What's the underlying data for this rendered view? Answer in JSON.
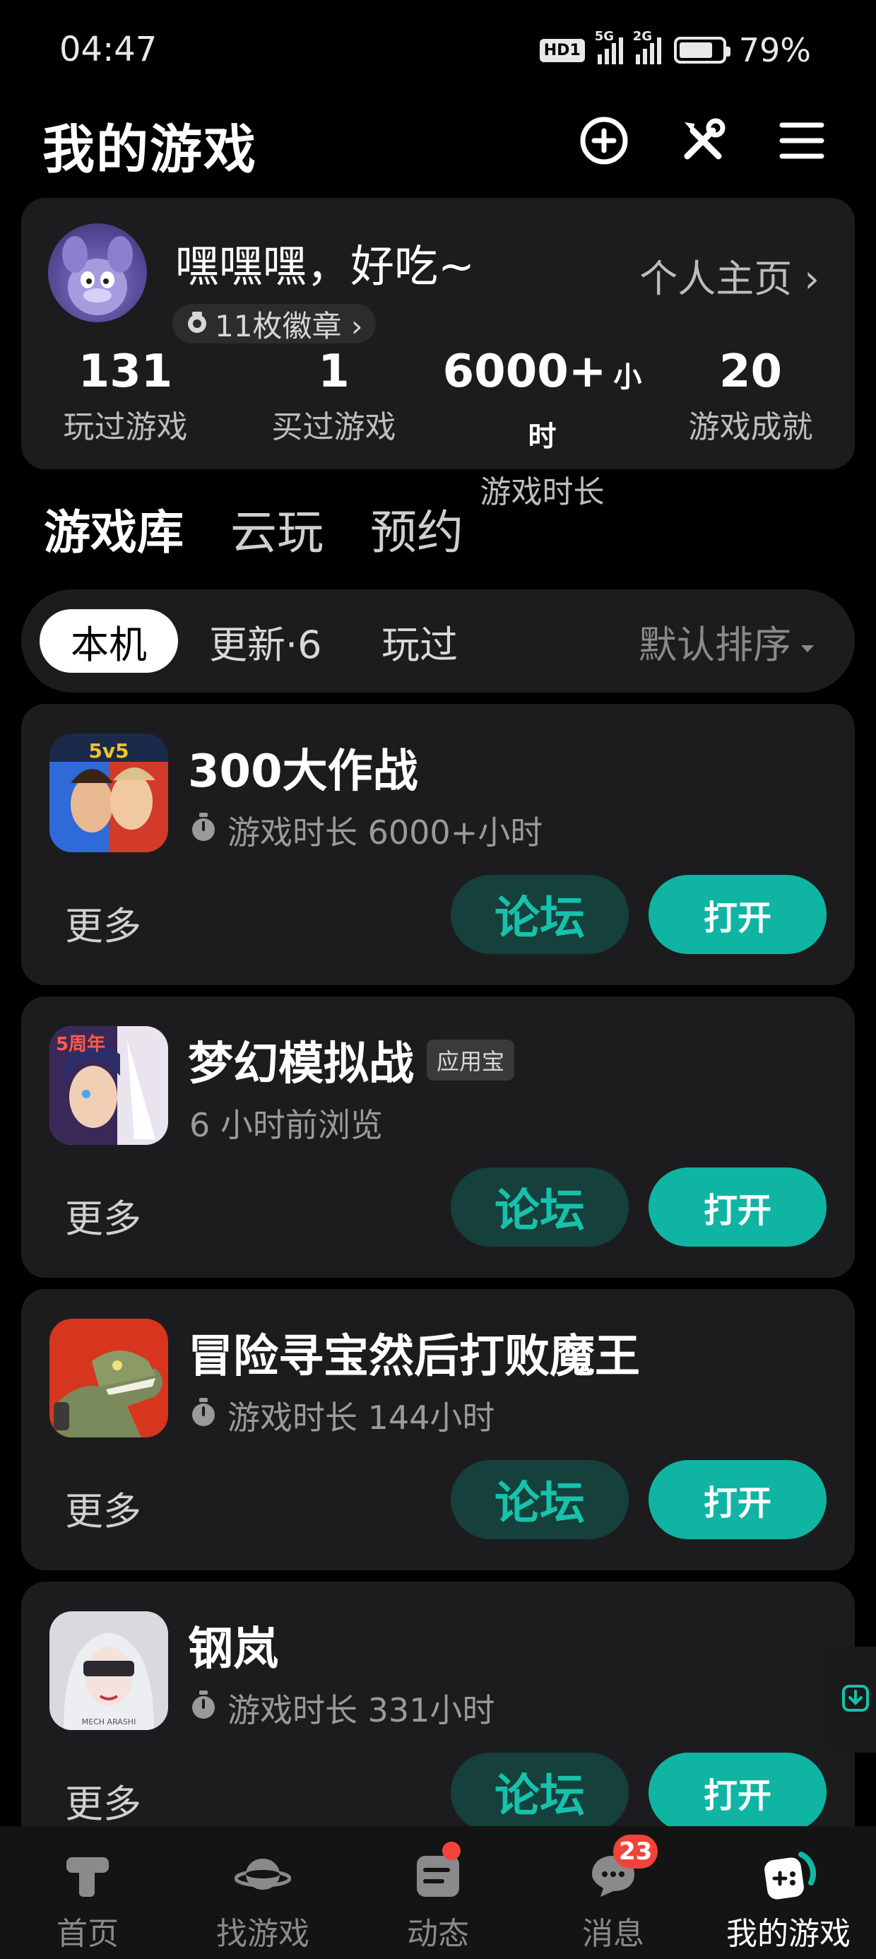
{
  "status_bar": {
    "time": "04:47",
    "hd_label": "HD1",
    "net1_label": "5G",
    "net2_label": "2G",
    "battery_level": 0.79,
    "battery_text": "79%"
  },
  "header": {
    "title": "我的游戏",
    "icons": [
      "add-circle-icon",
      "tools-icon",
      "menu-icon"
    ]
  },
  "profile": {
    "username": "嘿嘿嘿，好吃~",
    "homepage_label": "个人主页 ›",
    "badges_label": "11枚徽章 ›",
    "stats": [
      {
        "value": "131",
        "unit": "",
        "label": "玩过游戏"
      },
      {
        "value": "1",
        "unit": "",
        "label": "买过游戏"
      },
      {
        "value": "6000+",
        "unit": "小时",
        "label": "游戏时长"
      },
      {
        "value": "20",
        "unit": "",
        "label": "游戏成就"
      }
    ]
  },
  "library_tabs": [
    {
      "label": "游戏库",
      "active": true
    },
    {
      "label": "云玩",
      "active": false
    },
    {
      "label": "预约",
      "active": false
    }
  ],
  "filters": {
    "chips": [
      {
        "label": "本机",
        "active": true
      },
      {
        "label": "更新·6",
        "active": false
      },
      {
        "label": "玩过",
        "active": false
      }
    ],
    "sort_label": "默认排序"
  },
  "games": [
    {
      "name": "300大作战",
      "tag": "",
      "meta": "游戏时长 6000+小时",
      "show_timer": true,
      "more": "更多",
      "forum": "论坛",
      "open": "打开",
      "icon_overlay": "5v5"
    },
    {
      "name": "梦幻模拟战",
      "tag": "应用宝",
      "meta": "6 小时前浏览",
      "show_timer": false,
      "more": "更多",
      "forum": "论坛",
      "open": "打开",
      "icon_overlay": "5周年"
    },
    {
      "name": "冒险寻宝然后打败魔王",
      "tag": "",
      "meta": "游戏时长 144小时",
      "show_timer": true,
      "more": "更多",
      "forum": "论坛",
      "open": "打开",
      "icon_overlay": ""
    },
    {
      "name": "钢岚",
      "tag": "",
      "meta": "游戏时长 331小时",
      "show_timer": true,
      "more": "更多",
      "forum": "论坛",
      "open": "打开",
      "icon_overlay": "MECH ARASHI"
    }
  ],
  "bottom_nav": [
    {
      "label": "首页",
      "icon": "home-t-icon",
      "active": false
    },
    {
      "label": "找游戏",
      "icon": "planet-icon",
      "active": false
    },
    {
      "label": "动态",
      "icon": "feed-icon",
      "active": false,
      "dot": true
    },
    {
      "label": "消息",
      "icon": "chat-icon",
      "active": false,
      "badge": "23"
    },
    {
      "label": "我的游戏",
      "icon": "gamepad-icon",
      "active": true
    }
  ],
  "colors": {
    "accent": "#0fb5a2",
    "accent_dark": "#15403b",
    "card_bg": "#1c1c1e",
    "badge_red": "#f0443a"
  }
}
